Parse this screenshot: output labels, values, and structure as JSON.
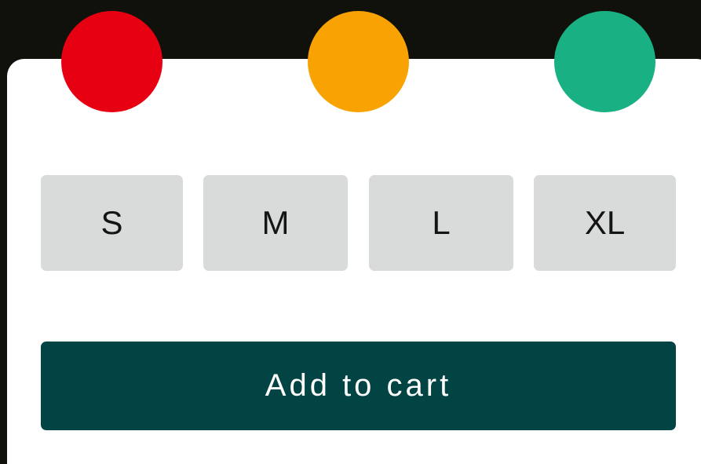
{
  "colors": {
    "background": "#11110c",
    "card": "#ffffff",
    "size_button_bg": "#d9dbda",
    "cart_button_bg": "#024443"
  },
  "color_options": [
    {
      "name": "red",
      "hex": "#e60012"
    },
    {
      "name": "orange",
      "hex": "#f8a203"
    },
    {
      "name": "green",
      "hex": "#19b084"
    }
  ],
  "sizes": [
    "S",
    "M",
    "L",
    "XL"
  ],
  "cart": {
    "label": "Add to cart"
  }
}
